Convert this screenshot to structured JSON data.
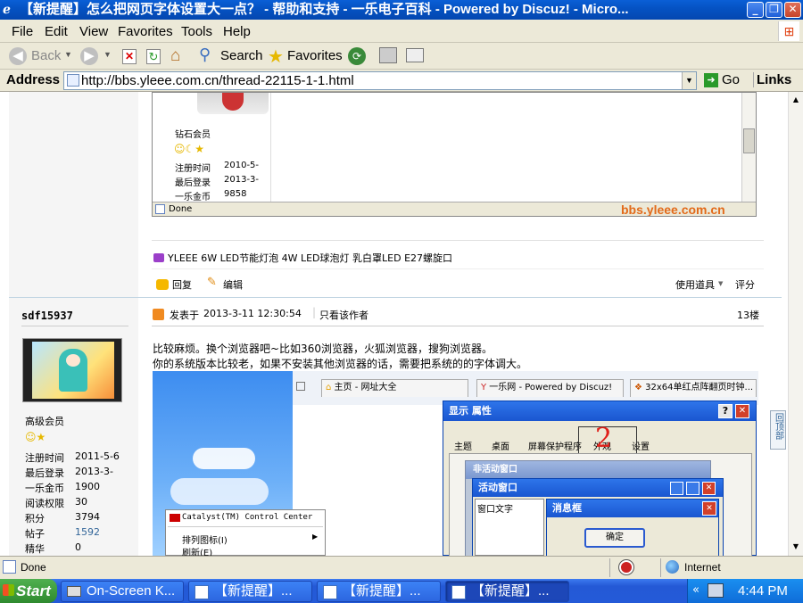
{
  "window": {
    "title": "【新提醒】怎么把网页字体设置大一点？ - 帮助和支持 - 一乐电子百科 - Powered by Discuz! - Micro..."
  },
  "menu": [
    "File",
    "Edit",
    "View",
    "Favorites",
    "Tools",
    "Help"
  ],
  "toolbar": {
    "back": "Back",
    "search": "Search",
    "favorites": "Favorites"
  },
  "address": {
    "label": "Address",
    "url": "http://bbs.yleee.com.cn/thread-22115-1-1.html",
    "go": "Go",
    "links": "Links"
  },
  "inner_screenshot_top": {
    "rank": "钻石会员",
    "rows": [
      {
        "label": "注册时间",
        "value": "2010-5-"
      },
      {
        "label": "最后登录",
        "value": "2013-3-"
      },
      {
        "label": "一乐金币",
        "value": "9858"
      }
    ],
    "status": "Done",
    "watermark": "bbs.yleee.com.cn"
  },
  "ad_link": "YLEEE 6W LED节能灯泡 4W LED球泡灯 乳白罩LED E27螺旋口",
  "post_actions": {
    "reply": "回复",
    "edit": "编辑",
    "tools": "使用道具",
    "rate": "评分"
  },
  "post": {
    "author": "sdf15937",
    "posted_prefix": "发表于",
    "posted_time": "2013-3-11 12:30:54",
    "only_author": "只看该作者",
    "floor": "13楼",
    "rank": "高级会员",
    "stats": [
      {
        "label": "注册时间",
        "value": "2011-5-6"
      },
      {
        "label": "最后登录",
        "value": "2013-3-"
      },
      {
        "label": "一乐金币",
        "value": "1900"
      },
      {
        "label": "阅读权限",
        "value": "30"
      },
      {
        "label": "积分",
        "value": "3794"
      },
      {
        "label": "帖子",
        "value": "1592"
      },
      {
        "label": "精华",
        "value": "0"
      }
    ],
    "line1": "比较麻烦。换个浏览器吧~比如360浏览器，火狐浏览器，搜狗浏览器。",
    "line2": "你的系统版本比较老，如果不安装其他浏览器的话，需要把系统的的字体调大。"
  },
  "back_to_top": "回顶部",
  "embedded_image": {
    "tabs": [
      "主页 - 网址大全",
      "一乐网 - Powered by Discuz!",
      "32x64单红点阵翻页时钟..."
    ],
    "context_menu": {
      "title": "Catalyst(TM) Control Center",
      "items": [
        "排列图标(I)",
        "刷新(E)"
      ]
    },
    "display_dialog": {
      "title": "显示 属性",
      "tabs": [
        "主题",
        "桌面",
        "屏幕保护程序",
        "外观",
        "设置"
      ]
    },
    "inactive_window": "非活动窗口",
    "active_window": "活动窗口",
    "window_text": "窗口文字",
    "message_box": "消息框",
    "ok": "确定"
  },
  "statusbar": {
    "status": "Done",
    "zone": "Internet"
  },
  "taskbar": {
    "start": "Start",
    "items": [
      "On-Screen K...",
      "【新提醒】...",
      "【新提醒】...",
      "【新提醒】..."
    ],
    "time": "4:44 PM"
  },
  "colors": {
    "title_blue": "#0553c4",
    "link_blue": "#336699",
    "annotation_red": "#e0201a"
  }
}
